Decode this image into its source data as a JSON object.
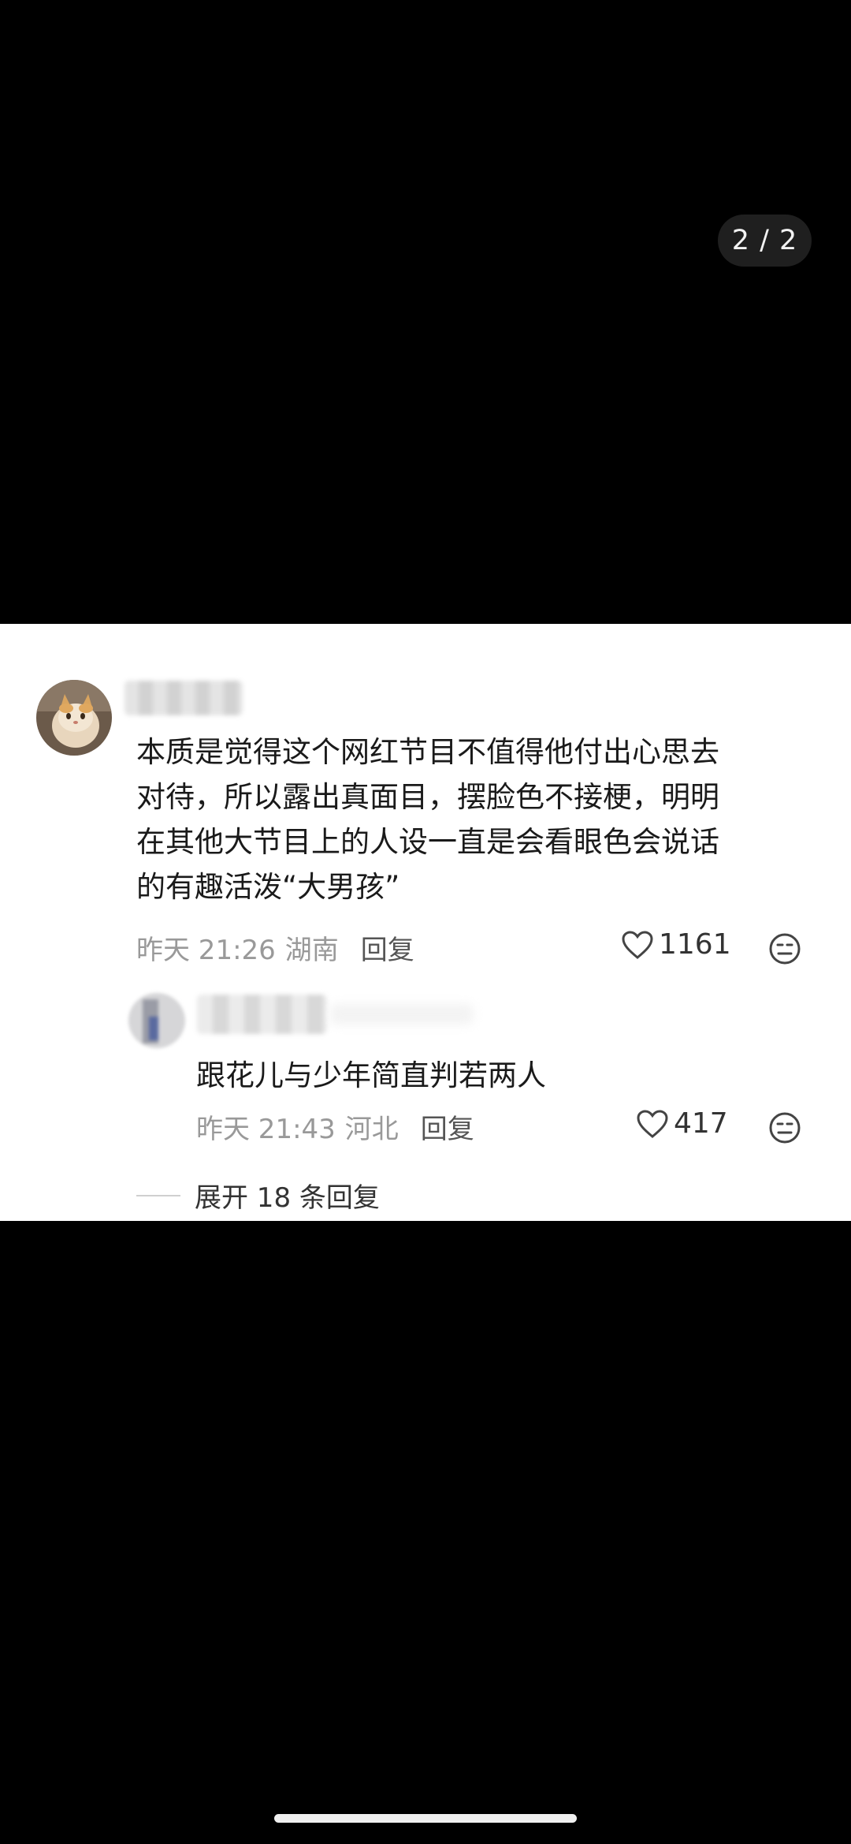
{
  "pager": {
    "label": "2 / 2"
  },
  "comment": {
    "text_lines": [
      "本质是觉得这个网红节目不值得他付出心思去",
      "对待，所以露出真面目，摆脸色不接梗，明明",
      "在其他大节目上的人设一直是会看眼色会说话",
      "的有趣活泼“大男孩”"
    ],
    "time": "昨天 21:26",
    "location": "湖南",
    "reply_label": "回复",
    "likes": "1161"
  },
  "reply": {
    "text": "跟花儿与少年简直判若两人",
    "time": "昨天 21:43",
    "location": "河北",
    "reply_label": "回复",
    "likes": "417"
  },
  "expand": {
    "label": "展开 18 条回复"
  },
  "icons": {
    "heart": "heart-outline-icon",
    "emoji": "neutral-face-icon"
  },
  "colors": {
    "background": "#000000",
    "card": "#ffffff",
    "meta_text": "#999999",
    "body_text": "#1a1a1a"
  }
}
